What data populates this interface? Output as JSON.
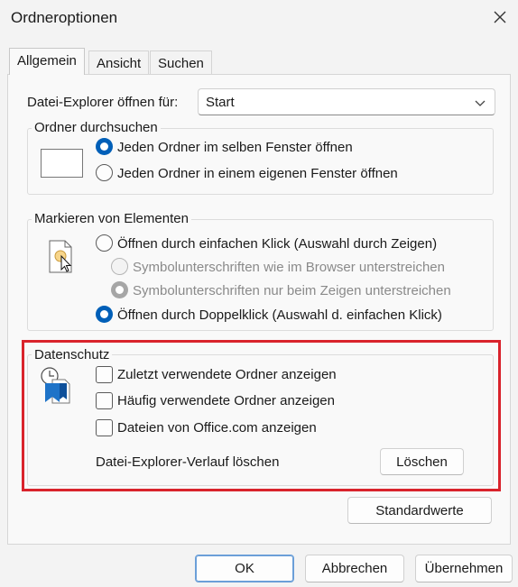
{
  "window": {
    "title": "Ordneroptionen"
  },
  "tabs": [
    {
      "label": "Allgemein",
      "active": true
    },
    {
      "label": "Ansicht",
      "active": false
    },
    {
      "label": "Suchen",
      "active": false
    }
  ],
  "open_for": {
    "label": "Datei-Explorer öffnen für:",
    "value": "Start"
  },
  "browse_folders": {
    "legend": "Ordner durchsuchen",
    "options": [
      {
        "label": "Jeden Ordner im selben Fenster öffnen",
        "selected": true
      },
      {
        "label": "Jeden Ordner in einem eigenen Fenster öffnen",
        "selected": false
      }
    ]
  },
  "click_items": {
    "legend": "Markieren von Elementen",
    "single_click": "Öffnen durch einfachen Klick (Auswahl durch Zeigen)",
    "underline_browser": "Symbolunterschriften wie im Browser unterstreichen",
    "underline_hover": "Symbolunterschriften nur beim Zeigen unterstreichen",
    "double_click": "Öffnen durch Doppelklick (Auswahl d. einfachen Klick)"
  },
  "privacy": {
    "legend": "Datenschutz",
    "options": [
      {
        "label": "Zuletzt verwendete Ordner anzeigen",
        "checked": false
      },
      {
        "label": "Häufig verwendete Ordner anzeigen",
        "checked": false
      },
      {
        "label": "Dateien von Office.com anzeigen",
        "checked": false
      }
    ],
    "clear_label": "Datei-Explorer-Verlauf löschen",
    "clear_button": "Löschen"
  },
  "restore_defaults": "Standardwerte",
  "footer": {
    "ok": "OK",
    "cancel": "Abbrechen",
    "apply": "Übernehmen"
  },
  "colors": {
    "accent": "#005fb8",
    "highlight": "#d9232c"
  }
}
